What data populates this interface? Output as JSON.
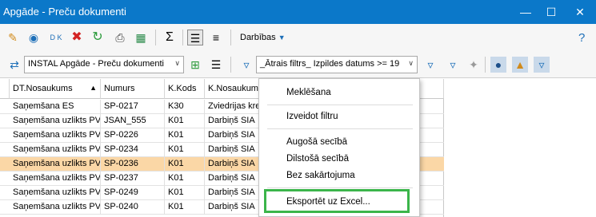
{
  "window": {
    "title": "Apgāde - Preču dokumenti"
  },
  "toolbar": {
    "darbibas_label": "Darbības",
    "help_label": "?"
  },
  "selector": {
    "value": "INSTAL Apgāde - Preču dokumenti"
  },
  "filter": {
    "value": "_Ātrais filtrs_ Izpildes datums >= 19"
  },
  "grid": {
    "columns": [
      "DT.Nosaukums",
      "Numurs",
      "K.Kods",
      "K.Nosaukums"
    ],
    "rows": [
      [
        "Saņemšana ES",
        "SP-0217",
        "K30",
        "Zviedrijas kred"
      ],
      [
        "Saņemšana uzlikts PVN",
        "JSAN_555",
        "K01",
        "Darbiņš SIA"
      ],
      [
        "Saņemšana uzlikts PVN",
        "SP-0226",
        "K01",
        "Darbiņš SIA"
      ],
      [
        "Saņemšana uzlikts PVN",
        "SP-0234",
        "K01",
        "Darbiņš SIA"
      ],
      [
        "Saņemšana uzlikts PVN",
        "SP-0236",
        "K01",
        "Darbiņš SIA"
      ],
      [
        "Saņemšana uzlikts PVN",
        "SP-0237",
        "K01",
        "Darbiņš SIA"
      ],
      [
        "Saņemšana uzlikts PVN",
        "SP-0249",
        "K01",
        "Darbiņš SIA"
      ],
      [
        "Saņemšana uzlikts PVN",
        "SP-0240",
        "K01",
        "Darbiņš SIA"
      ]
    ],
    "selected_row": "SP-0236"
  },
  "context_menu": {
    "items": [
      "Meklēšana",
      "Izveidot filtru",
      "Augošā secībā",
      "Dilstošā secībā",
      "Bez sakārtojuma",
      "Eksportēt uz Excel..."
    ],
    "highlighted": "Eksportēt uz Excel..."
  },
  "colors": {
    "titlebar": "#0b78c9",
    "selection": "#fbd7a6",
    "highlight_border": "#3bb54a"
  }
}
